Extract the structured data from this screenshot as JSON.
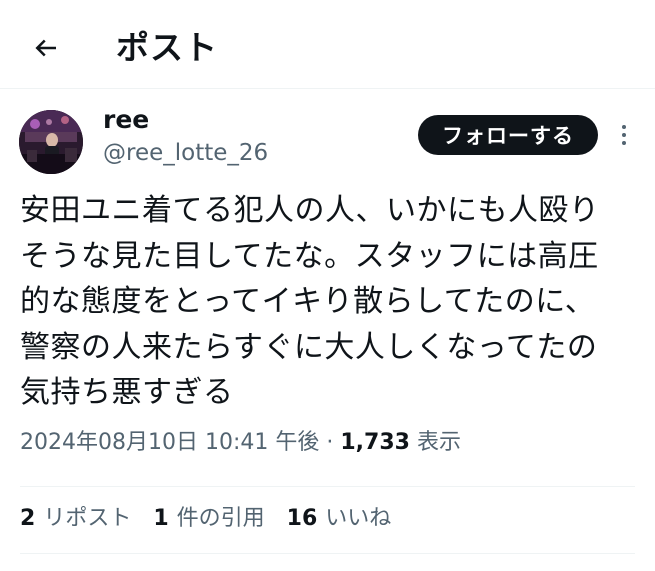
{
  "header": {
    "back_icon": "arrow-left-icon",
    "title": "ポスト"
  },
  "author": {
    "display_name": "ree",
    "handle": "@ree_lotte_26",
    "avatar_icon": "user-avatar"
  },
  "follow_button": {
    "label": "フォローする"
  },
  "more_icon": "vertical-ellipsis-icon",
  "tweet": {
    "text": "安田ユニ着てる犯人の人、いかにも人殴り\nそうな見た目してたな。スタッフには高圧\n的な態度をとってイキり散らしてたのに、\n警察の人来たらすぐに大人しくなってたの\n気持ち悪すぎる"
  },
  "meta": {
    "timestamp": "2024年08月10日 10:41 午後",
    "separator": "·",
    "views_count": "1,733",
    "views_label": "表示"
  },
  "stats": {
    "reposts_count": "2",
    "reposts_label": "リポスト",
    "quotes_count": "1",
    "quotes_label": "件の引用",
    "likes_count": "16",
    "likes_label": "いいね"
  },
  "colors": {
    "text_primary": "#0f1419",
    "text_secondary": "#536471",
    "divider": "#eff3f4",
    "button_bg": "#0f1419",
    "button_text": "#ffffff"
  }
}
